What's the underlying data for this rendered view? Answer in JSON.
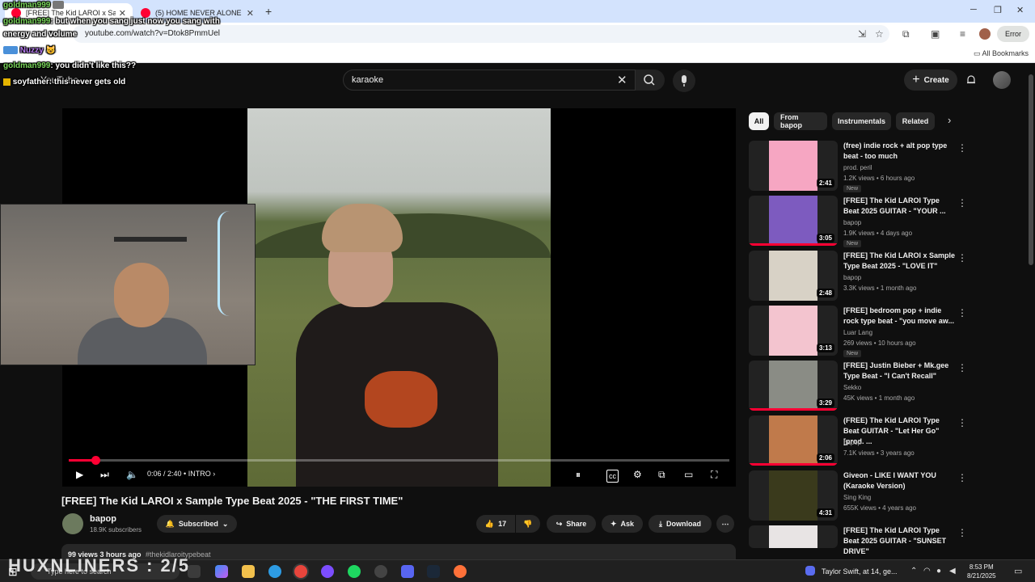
{
  "browser": {
    "tabs": [
      {
        "title": "[FREE] The Kid LAROI x Sample"
      },
      {
        "title": "(5) HOME NEVER ALONE by bo"
      }
    ],
    "url": "youtube.com/watch?v=Dtok8PmmUel",
    "error_chip": "Error",
    "all_bookmarks": "All Bookmarks"
  },
  "yt": {
    "logo_text": "YouTube",
    "search_value": "karaoke",
    "create_label": "Create"
  },
  "player": {
    "time": "0:06 / 2:40",
    "chapter": "INTRO",
    "progress_fraction": 0.04
  },
  "video": {
    "title": "[FREE] The Kid LAROI x Sample Type Beat 2025 - \"THE FIRST TIME\"",
    "channel": "bapop",
    "subscribers": "18.9K subscribers",
    "subscribed_label": "Subscribed",
    "likes": "17",
    "share_label": "Share",
    "ask_label": "Ask",
    "download_label": "Download",
    "views_line": "99 views  3 hours ago",
    "hashtag": "#thekidlaroitypebeat"
  },
  "chips": [
    "All",
    "From bapop",
    "Instrumentals",
    "Related"
  ],
  "recommendations": [
    {
      "title": "(free) indie rock + alt pop type beat - too much",
      "channel": "prod. peril",
      "meta": "1.2K views • 6 hours ago",
      "duration": "2:41",
      "badge": "New",
      "watched": 0,
      "color": "#f6a6c2"
    },
    {
      "title": "[FREE] The Kid LAROI Type Beat 2025 GUITAR - \"YOUR ...",
      "channel": "bapop",
      "meta": "1.9K views • 4 days ago",
      "duration": "3:05",
      "badge": "New",
      "watched": 1,
      "color": "#7d5bbf"
    },
    {
      "title": "[FREE] The Kid LAROI x Sample Type Beat 2025 - \"LOVE IT\"",
      "channel": "bapop",
      "meta": "3.3K views • 1 month ago",
      "duration": "2:48",
      "badge": "",
      "watched": 0,
      "color": "#d8d2c6"
    },
    {
      "title": "[FREE] bedroom pop + indie rock type beat - \"you move aw...",
      "channel": "Luar Lang",
      "meta": "269 views • 10 hours ago",
      "duration": "3:13",
      "badge": "New",
      "watched": 0,
      "color": "#f3c4cf"
    },
    {
      "title": "[FREE] Justin Bieber + Mk.gee Type Beat - \"I Can't Recall\"",
      "channel": "Sekko",
      "meta": "45K views • 1 month ago",
      "duration": "3:29",
      "badge": "",
      "watched": 1,
      "color": "#8a8c85"
    },
    {
      "title": "(FREE) The Kid LAROI Type Beat GUITAR - \"Let Her Go\" [prod. ...",
      "channel": "bapop",
      "meta": "7.1K views • 3 years ago",
      "duration": "2:06",
      "badge": "",
      "watched": 1,
      "color": "#c07a4b"
    },
    {
      "title": "Giveon - LIKE I WANT YOU (Karaoke Version)",
      "channel": "Sing King",
      "meta": "655K views • 4 years ago",
      "duration": "4:31",
      "badge": "",
      "watched": 0,
      "color": "#3a3a1c"
    },
    {
      "title": "[FREE] The Kid LAROI Type Beat 2025 GUITAR - \"SUNSET DRIVE\"",
      "channel": "",
      "meta": "",
      "duration": "",
      "badge": "",
      "watched": 0,
      "color": "#e8e4e4"
    }
  ],
  "chat": [
    {
      "user": "goldman999",
      "message": ""
    },
    {
      "user": "goldman999",
      "message": ": but when you sang just now you sang with"
    },
    {
      "user": "",
      "message": "energy and volume"
    },
    {
      "user": "Nuzzy",
      "message": ""
    },
    {
      "user": "goldman999",
      "message": ": you didn't like this??"
    },
    {
      "user": "soyfather",
      "message": ": this never gets old"
    }
  ],
  "taskbar": {
    "search_placeholder": "Type here to search",
    "watermark": "HUXNLINERS : 2/5",
    "news": "Taylor Swift, at 14, ge...",
    "time": "8:53 PM",
    "date": "8/21/2025"
  },
  "colors": {
    "accent": "#ff0033",
    "chat_user": "#7ad65b",
    "background": "#0f0f0f"
  }
}
